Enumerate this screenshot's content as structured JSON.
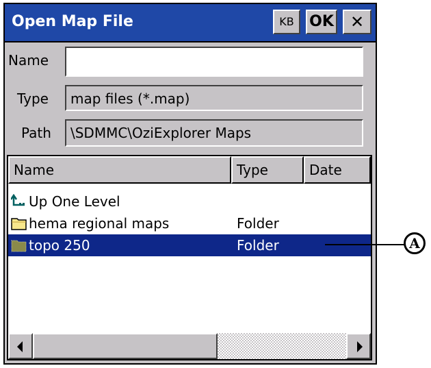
{
  "window": {
    "title": "Open Map File",
    "kb_label": "KB",
    "ok_label": "OK",
    "close_label": "✕"
  },
  "form": {
    "name_label": "Name",
    "name_value": "",
    "type_label": "Type",
    "type_value": "map files (*.map)",
    "path_label": "Path",
    "path_value": "\\SDMMC\\OziExplorer Maps"
  },
  "list": {
    "columns": [
      "Name",
      "Type",
      "Date"
    ],
    "rows": [
      {
        "name": "Up One Level",
        "type": "",
        "icon": "up-level-icon"
      },
      {
        "name": "hema regional maps",
        "type": "Folder",
        "icon": "folder-icon"
      },
      {
        "name": "topo 250",
        "type": "Folder",
        "icon": "folder-icon",
        "selected": true
      }
    ]
  },
  "callout": {
    "label": "A"
  },
  "colors": {
    "title_bar": "#1f48a7",
    "selection": "#0e2789",
    "dialog_face": "#c6c3c6"
  }
}
